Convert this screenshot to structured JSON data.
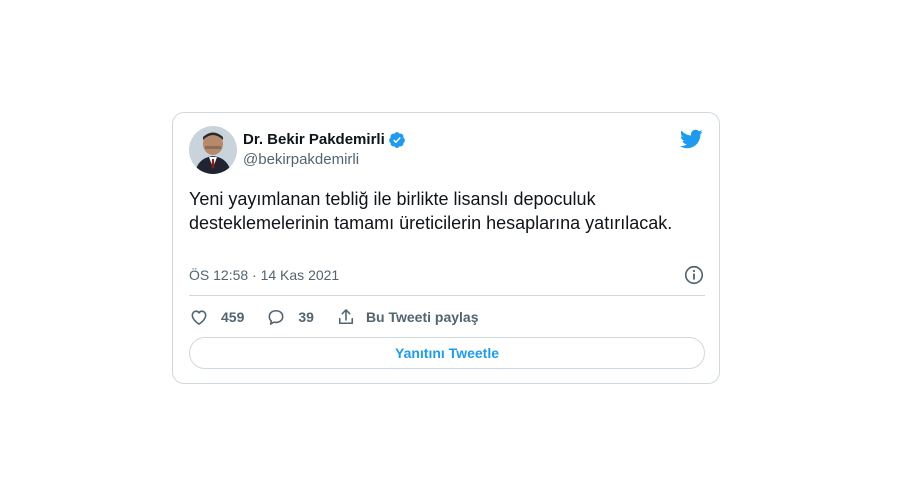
{
  "author": {
    "display_name": "Dr. Bekir Pakdemirli",
    "handle": "@bekirpakdemirli",
    "verified": true,
    "avatar_icon": "profile-photo"
  },
  "tweet": {
    "text": "Yeni yayımlanan tebliğ ile birlikte lisanslı depoculuk desteklemelerinin tamamı üreticilerin hesaplarına yatırılacak.",
    "timestamp": "ÖS 12:58 · 14 Kas 2021"
  },
  "actions": {
    "like_count": "459",
    "reply_count": "39",
    "share_label": "Bu Tweeti paylaş"
  },
  "reply_button_label": "Yanıtını Tweetle",
  "colors": {
    "accent": "#1d9bf0",
    "text_primary": "#0f1419",
    "text_secondary": "#536471",
    "border": "#cfd9de"
  },
  "icons": [
    "verified-badge-icon",
    "twitter-logo-icon",
    "info-icon",
    "heart-icon",
    "reply-bubble-icon",
    "share-icon"
  ]
}
